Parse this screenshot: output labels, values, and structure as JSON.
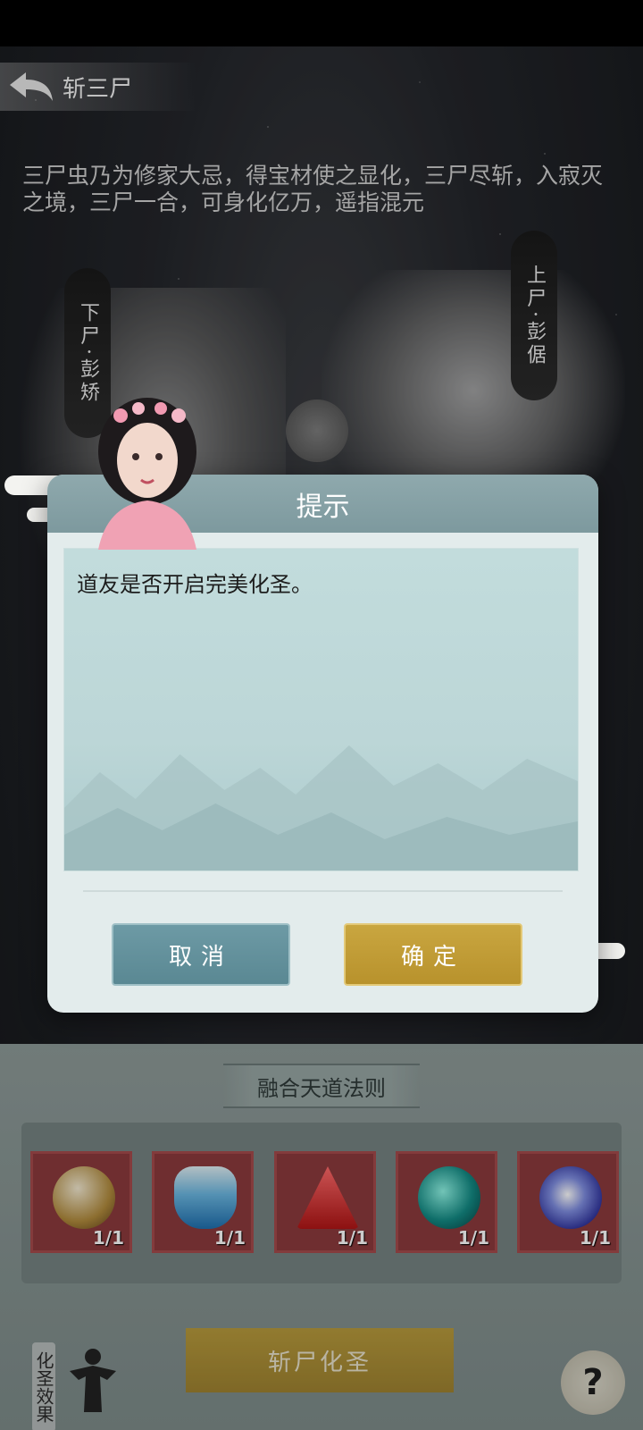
{
  "header": {
    "title": "斩三尸"
  },
  "intro_text": "三尸虫乃为修家大忌，得宝材使之显化，三尸尽斩，入寂灭之境，三尸一合，可身化亿万，遥指混元",
  "scrolls": {
    "left": "下尸·彭矫",
    "right": "上尸·彭倨"
  },
  "dialog": {
    "title": "提示",
    "message": "道友是否开启完美化圣。",
    "cancel_label": "取消",
    "confirm_label": "确定"
  },
  "panel": {
    "title": "融合天道法则",
    "items": [
      {
        "icon": "treasure-pagoda-icon",
        "count": "1/1"
      },
      {
        "icon": "blue-bottle-icon",
        "count": "1/1"
      },
      {
        "icon": "red-crystal-icon",
        "count": "1/1"
      },
      {
        "icon": "green-orb-icon",
        "count": "1/1"
      },
      {
        "icon": "blue-swirl-orb-icon",
        "count": "1/1"
      }
    ],
    "action_label": "斩尸化圣",
    "effect_label": "化圣效果",
    "help_label": "?"
  },
  "colors": {
    "cancel": "#5a8893",
    "confirm": "#b8922c",
    "dialog_head": "#7d999e",
    "item_bg": "#8b3a3c"
  }
}
